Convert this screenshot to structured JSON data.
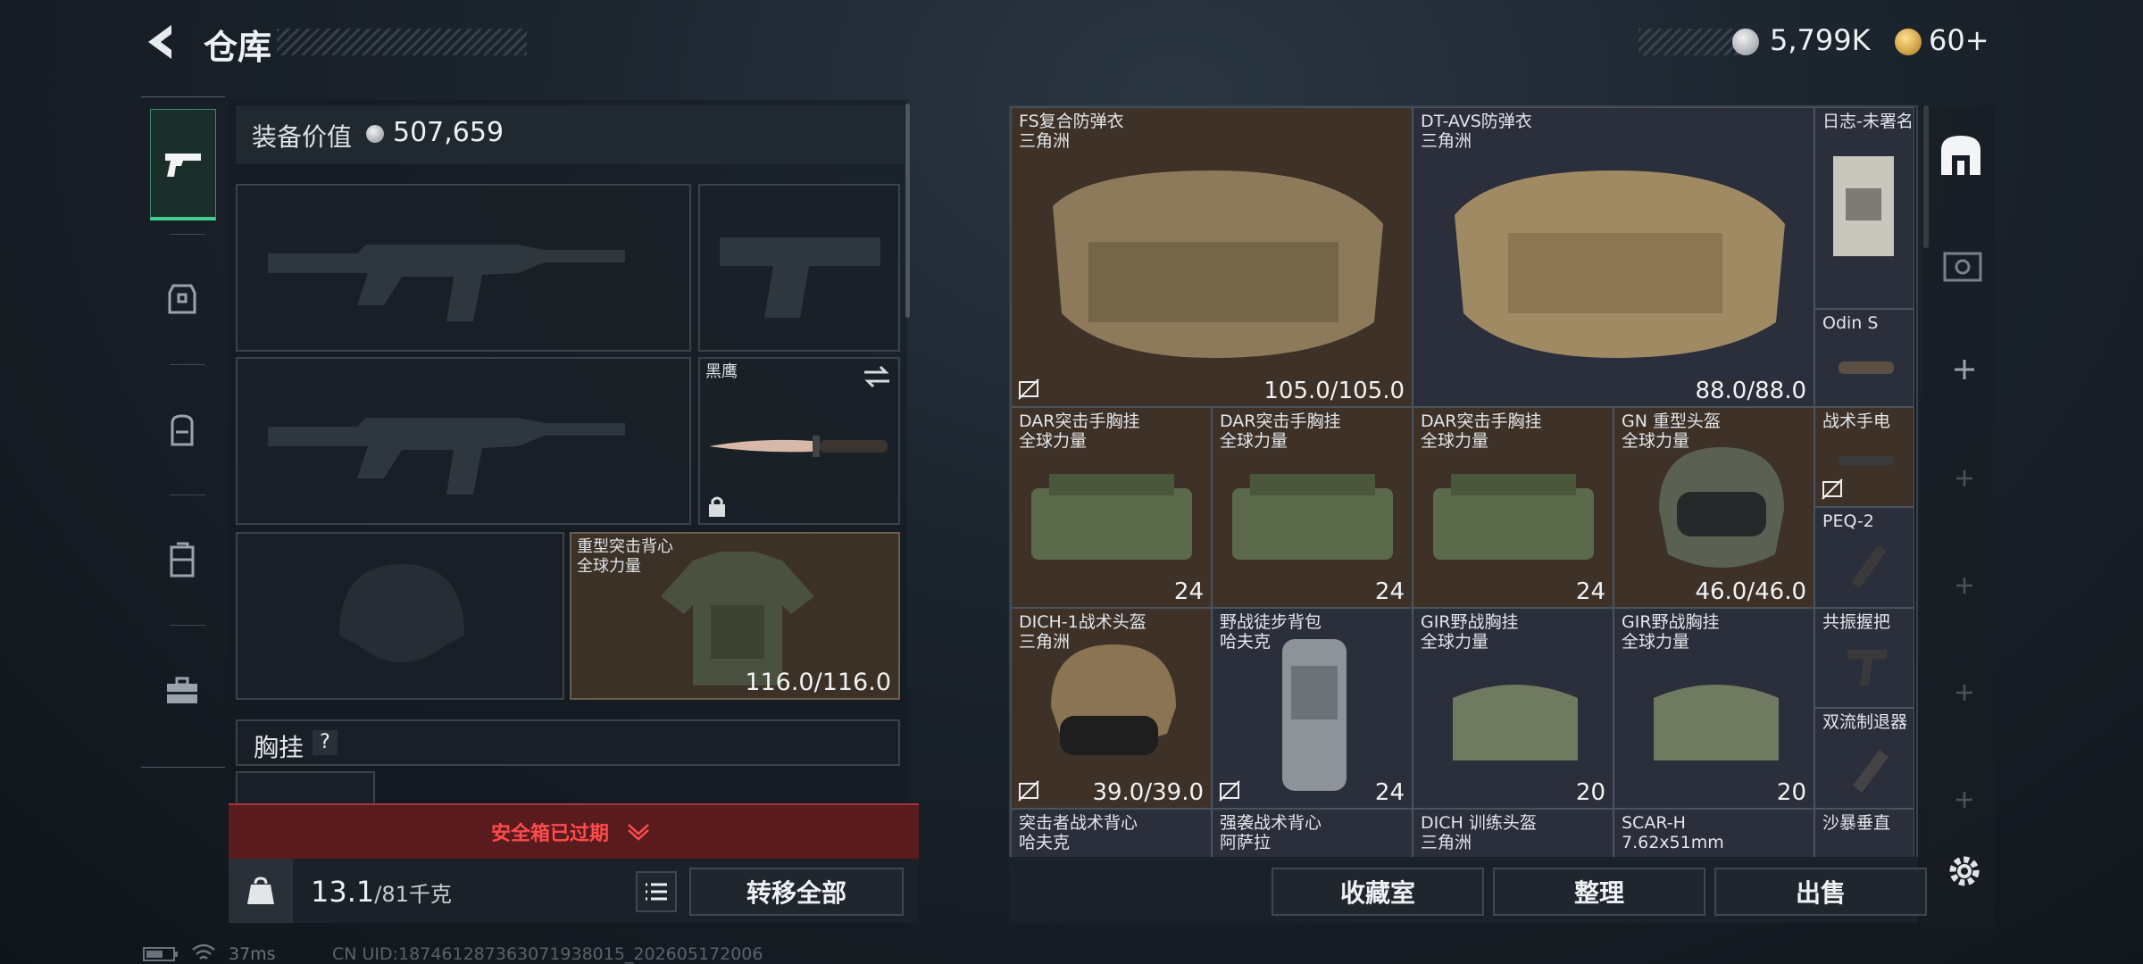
{
  "header": {
    "title": "仓库",
    "currency_silver": "5,799K",
    "currency_gold": "60+"
  },
  "colors": {
    "accent_green": "#3fcf8e",
    "alert_red": "#e23b3b",
    "slot_brown": "#3d3128"
  },
  "equipment": {
    "value_label": "装备价值",
    "value": "507,659",
    "knife_name": "黑鹰",
    "armor_name": "重型突击背心",
    "armor_faction": "全球力量",
    "armor_durability": "116.0/116.0",
    "chest_label": "胸挂",
    "chest_help": "?"
  },
  "alert": {
    "text": "安全箱已过期"
  },
  "weight": {
    "current": "13.1",
    "max": "/81千克"
  },
  "buttons": {
    "transfer_all": "转移全部",
    "collection": "收藏室",
    "organize": "整理",
    "sell": "出售"
  },
  "items": [
    {
      "name": "FS复合防弹衣",
      "sub": "三角洲",
      "durability": "105.0/105.0"
    },
    {
      "name": "DT-AVS防弹衣",
      "sub": "三角洲",
      "durability": "88.0/88.0"
    },
    {
      "name": "日志-未署名",
      "sub": ""
    },
    {
      "name": "Odin S",
      "sub": ""
    },
    {
      "name": "DAR突击手胸挂",
      "sub": "全球力量",
      "count": "24"
    },
    {
      "name": "DAR突击手胸挂",
      "sub": "全球力量",
      "count": "24"
    },
    {
      "name": "DAR突击手胸挂",
      "sub": "全球力量",
      "count": "24"
    },
    {
      "name": "GN 重型头盔",
      "sub": "全球力量",
      "durability": "46.0/46.0"
    },
    {
      "name": "战术手电",
      "sub": ""
    },
    {
      "name": "PEQ-2",
      "sub": ""
    },
    {
      "name": "DICH-1战术头盔",
      "sub": "三角洲",
      "durability": "39.0/39.0"
    },
    {
      "name": "野战徒步背包",
      "sub": "哈夫克",
      "count": "24"
    },
    {
      "name": "GIR野战胸挂",
      "sub": "全球力量",
      "count": "20"
    },
    {
      "name": "GIR野战胸挂",
      "sub": "全球力量",
      "count": "20"
    },
    {
      "name": "共振握把",
      "sub": ""
    },
    {
      "name": "双流制退器",
      "sub": ""
    },
    {
      "name": "突击者战术背心",
      "sub": "哈夫克"
    },
    {
      "name": "强袭战术背心",
      "sub": "阿萨拉"
    },
    {
      "name": "DICH 训练头盔",
      "sub": "三角洲"
    },
    {
      "name": "SCAR-H",
      "sub": "7.62x51mm"
    },
    {
      "name": "沙暴垂直",
      "sub": ""
    }
  ],
  "status": {
    "ping": "37ms",
    "uid": "CN UID:187461287363071938015_202605172006"
  }
}
